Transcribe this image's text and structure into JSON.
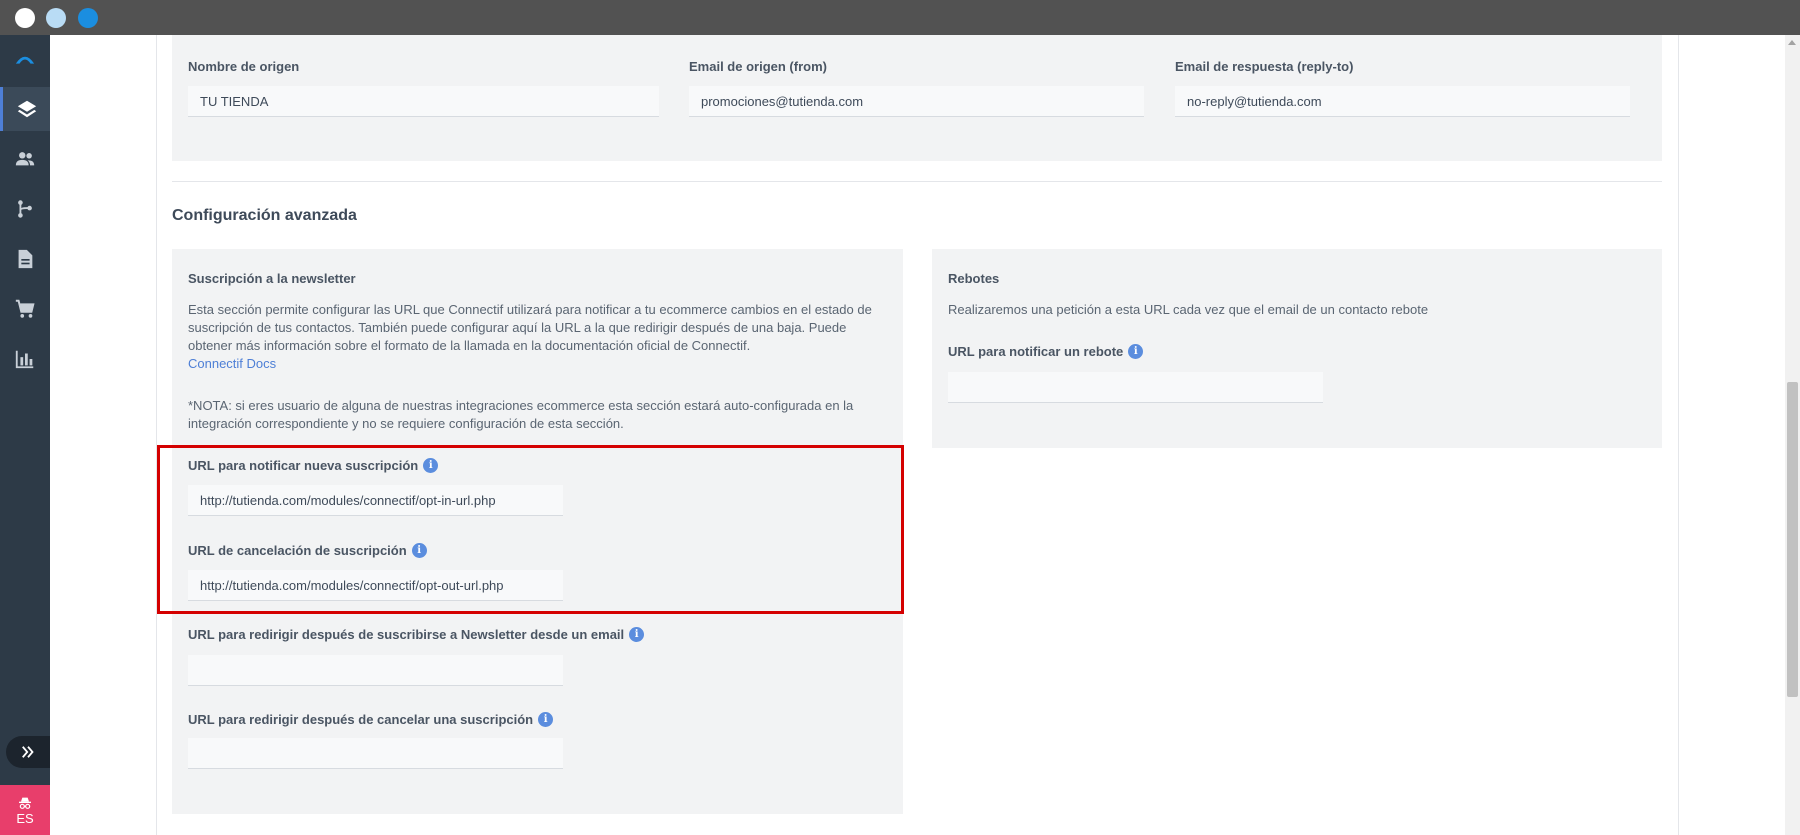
{
  "window": {
    "traffic_colors": [
      "#ffffff",
      "#b9dcf5",
      "#1b8ee0"
    ]
  },
  "sidebar": {
    "icons": [
      "connectif-logo-icon",
      "layers-icon",
      "contacts-icon",
      "workflow-icon",
      "document-icon",
      "cart-icon",
      "chart-icon"
    ],
    "active": "layers-icon",
    "expand_icon": "double-chevron-right-icon",
    "language_icon": "incognito-icon",
    "language": "ES"
  },
  "sender": {
    "origin_name_label": "Nombre de origen",
    "origin_name_value": "TU TIENDA",
    "from_email_label": "Email de origen (from)",
    "from_email_value": "promociones@tutienda.com",
    "reply_email_label": "Email de respuesta (reply-to)",
    "reply_email_value": "no-reply@tutienda.com"
  },
  "advanced": {
    "title": "Configuración avanzada",
    "subscription": {
      "title": "Suscripción a la newsletter",
      "description": "Esta sección permite configurar las URL que Connectif utilizará para notificar a tu ecommerce cambios en el estado de suscripción de tus contactos. También puede configurar aquí la URL a la que redirigir después de una baja. Puede obtener más información sobre el formato de la llamada en la documentación oficial de Connectif.",
      "docs_link": "Connectif Docs",
      "note": "*NOTA: si eres usuario de alguna de nuestras integraciones ecommerce esta sección estará auto-configurada en la integración correspondiente y no se requiere configuración de esta sección.",
      "optin_label": "URL para notificar nueva suscripción",
      "optin_value": "http://tutienda.com/modules/connectif/opt-in-url.php",
      "optout_label": "URL de cancelación de suscripción",
      "optout_value": "http://tutienda.com/modules/connectif/opt-out-url.php",
      "redirect_subscribe_label": "URL para redirigir después de suscribirse a Newsletter desde un email",
      "redirect_subscribe_value": "",
      "redirect_cancel_label": "URL para redirigir después de cancelar una suscripción",
      "redirect_cancel_value": ""
    },
    "bounces": {
      "title": "Rebotes",
      "description": "Realizaremos una petición a esta URL cada vez que el email de un contacto rebote",
      "url_label": "URL para notificar un rebote",
      "url_value": ""
    },
    "info_icon": "info-icon"
  },
  "colors": {
    "accent": "#4e7fd6",
    "highlight": "#d40000",
    "sidebar": "#2d3a47",
    "language_badge": "#e83e6b"
  }
}
